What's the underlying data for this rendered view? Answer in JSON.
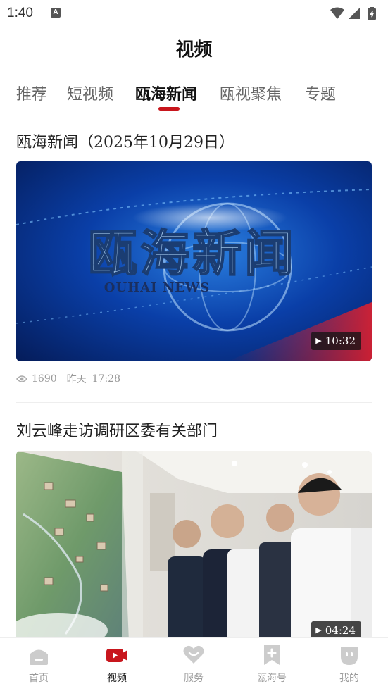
{
  "status_bar": {
    "time": "1:40",
    "notification_badge": "A"
  },
  "page": {
    "title": "视频"
  },
  "tabs": [
    {
      "label": "推荐",
      "active": false
    },
    {
      "label": "短视频",
      "active": false
    },
    {
      "label": "瓯海新闻",
      "active": true
    },
    {
      "label": "瓯视聚焦",
      "active": false
    },
    {
      "label": "专题",
      "active": false
    }
  ],
  "articles": [
    {
      "title": "瓯海新闻（2025年10月29日）",
      "duration": "10:32",
      "thumbnail": {
        "logo_text": "瓯海新闻",
        "logo_subtext": "OUHAI NEWS"
      },
      "views": "1690",
      "date": "昨天",
      "time": "17:28"
    },
    {
      "title": "刘云峰走访调研区委有关部门",
      "duration": "04:24"
    }
  ],
  "bottom_nav": [
    {
      "label": "首页",
      "icon": "home-icon",
      "active": false
    },
    {
      "label": "视频",
      "icon": "video-icon",
      "active": true
    },
    {
      "label": "服务",
      "icon": "heart-icon",
      "active": false
    },
    {
      "label": "瓯海号",
      "icon": "bookmark-plus-icon",
      "active": false
    },
    {
      "label": "我的",
      "icon": "profile-face-icon",
      "active": false
    }
  ],
  "colors": {
    "accent": "#c8161d",
    "inactive": "#c8c8c8",
    "text": "#222222",
    "muted": "#999999"
  }
}
